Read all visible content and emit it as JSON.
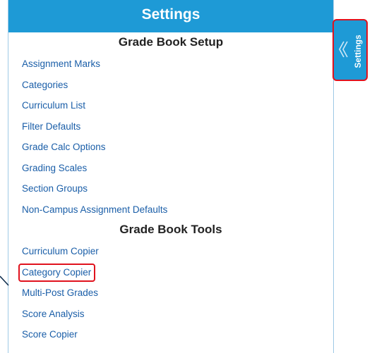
{
  "panel": {
    "title": "Settings"
  },
  "side_tab": {
    "label": "Settings",
    "icon": "double-chevron-left-icon"
  },
  "sections": [
    {
      "title": "Grade Book Setup",
      "items": [
        {
          "label": "Assignment Marks"
        },
        {
          "label": "Categories"
        },
        {
          "label": "Curriculum List"
        },
        {
          "label": "Filter Defaults"
        },
        {
          "label": "Grade Calc Options"
        },
        {
          "label": "Grading Scales"
        },
        {
          "label": "Section Groups"
        },
        {
          "label": "Non-Campus Assignment Defaults"
        }
      ]
    },
    {
      "title": "Grade Book Tools",
      "items": [
        {
          "label": "Curriculum Copier"
        },
        {
          "label": "Category Copier"
        },
        {
          "label": "Multi-Post Grades"
        },
        {
          "label": "Score Analysis"
        },
        {
          "label": "Score Copier"
        }
      ]
    }
  ],
  "colors": {
    "header_bg": "#1e9ad6",
    "link": "#1a5ea8",
    "highlight": "#e0121d"
  }
}
